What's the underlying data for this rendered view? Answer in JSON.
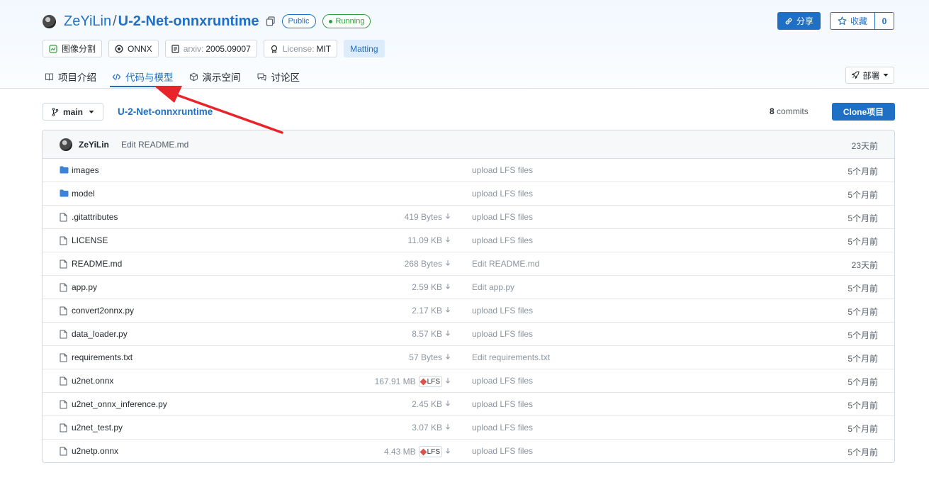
{
  "header": {
    "owner": "ZeYiLin",
    "separator": "/",
    "repo_name": "U-2-Net-onnxruntime",
    "visibility_badge": "Public",
    "status_badge": "Running",
    "share_label": "分享",
    "favorite_label": "收藏",
    "favorite_count": "0"
  },
  "tags": [
    {
      "label": "图像分割",
      "prefix": "",
      "icon": "image-segmentation-icon"
    },
    {
      "label": "ONNX",
      "prefix": "",
      "icon": "onnx-icon"
    },
    {
      "label": "2005.09007",
      "prefix": "arxiv:",
      "icon": "document-icon"
    },
    {
      "label": "MIT",
      "prefix": "License:",
      "icon": "license-icon"
    },
    {
      "label": "Matting",
      "prefix": "",
      "icon": ""
    }
  ],
  "tabs": [
    {
      "label": "项目介绍",
      "icon": "book-icon"
    },
    {
      "label": "代码与模型",
      "icon": "code-icon"
    },
    {
      "label": "演示空间",
      "icon": "cube-icon"
    },
    {
      "label": "讨论区",
      "icon": "chat-icon"
    }
  ],
  "deploy_label": "部署",
  "repo_bar": {
    "branch": "main",
    "repo_link": "U-2-Net-onnxruntime",
    "commit_count": "8",
    "commit_label": "commits",
    "clone_label": "Clone项目"
  },
  "latest_commit": {
    "author": "ZeYiLin",
    "message": "Edit README.md",
    "time": "23天前"
  },
  "files": [
    {
      "type": "folder",
      "name": "images",
      "size": "",
      "lfs": false,
      "message": "upload LFS files",
      "time": "5个月前"
    },
    {
      "type": "folder",
      "name": "model",
      "size": "",
      "lfs": false,
      "message": "upload LFS files",
      "time": "5个月前"
    },
    {
      "type": "file",
      "name": ".gitattributes",
      "size": "419 Bytes",
      "lfs": false,
      "message": "upload LFS files",
      "time": "5个月前"
    },
    {
      "type": "file",
      "name": "LICENSE",
      "size": "11.09 KB",
      "lfs": false,
      "message": "upload LFS files",
      "time": "5个月前"
    },
    {
      "type": "file",
      "name": "README.md",
      "size": "268 Bytes",
      "lfs": false,
      "message": "Edit README.md",
      "time": "23天前"
    },
    {
      "type": "file",
      "name": "app.py",
      "size": "2.59 KB",
      "lfs": false,
      "message": "Edit app.py",
      "time": "5个月前"
    },
    {
      "type": "file",
      "name": "convert2onnx.py",
      "size": "2.17 KB",
      "lfs": false,
      "message": "upload LFS files",
      "time": "5个月前"
    },
    {
      "type": "file",
      "name": "data_loader.py",
      "size": "8.57 KB",
      "lfs": false,
      "message": "upload LFS files",
      "time": "5个月前"
    },
    {
      "type": "file",
      "name": "requirements.txt",
      "size": "57 Bytes",
      "lfs": false,
      "message": "Edit requirements.txt",
      "time": "5个月前"
    },
    {
      "type": "file",
      "name": "u2net.onnx",
      "size": "167.91 MB",
      "lfs": true,
      "lfs_label": "LFS",
      "message": "upload LFS files",
      "time": "5个月前"
    },
    {
      "type": "file",
      "name": "u2net_onnx_inference.py",
      "size": "2.45 KB",
      "lfs": false,
      "message": "upload LFS files",
      "time": "5个月前"
    },
    {
      "type": "file",
      "name": "u2net_test.py",
      "size": "3.07 KB",
      "lfs": false,
      "message": "upload LFS files",
      "time": "5个月前"
    },
    {
      "type": "file",
      "name": "u2netp.onnx",
      "size": "4.43 MB",
      "lfs": true,
      "lfs_label": "LFS",
      "message": "upload LFS files",
      "time": "5个月前"
    }
  ],
  "colors": {
    "accent": "#1f6fc5",
    "running": "#2ea043",
    "annotation_arrow": "#e8232a"
  }
}
